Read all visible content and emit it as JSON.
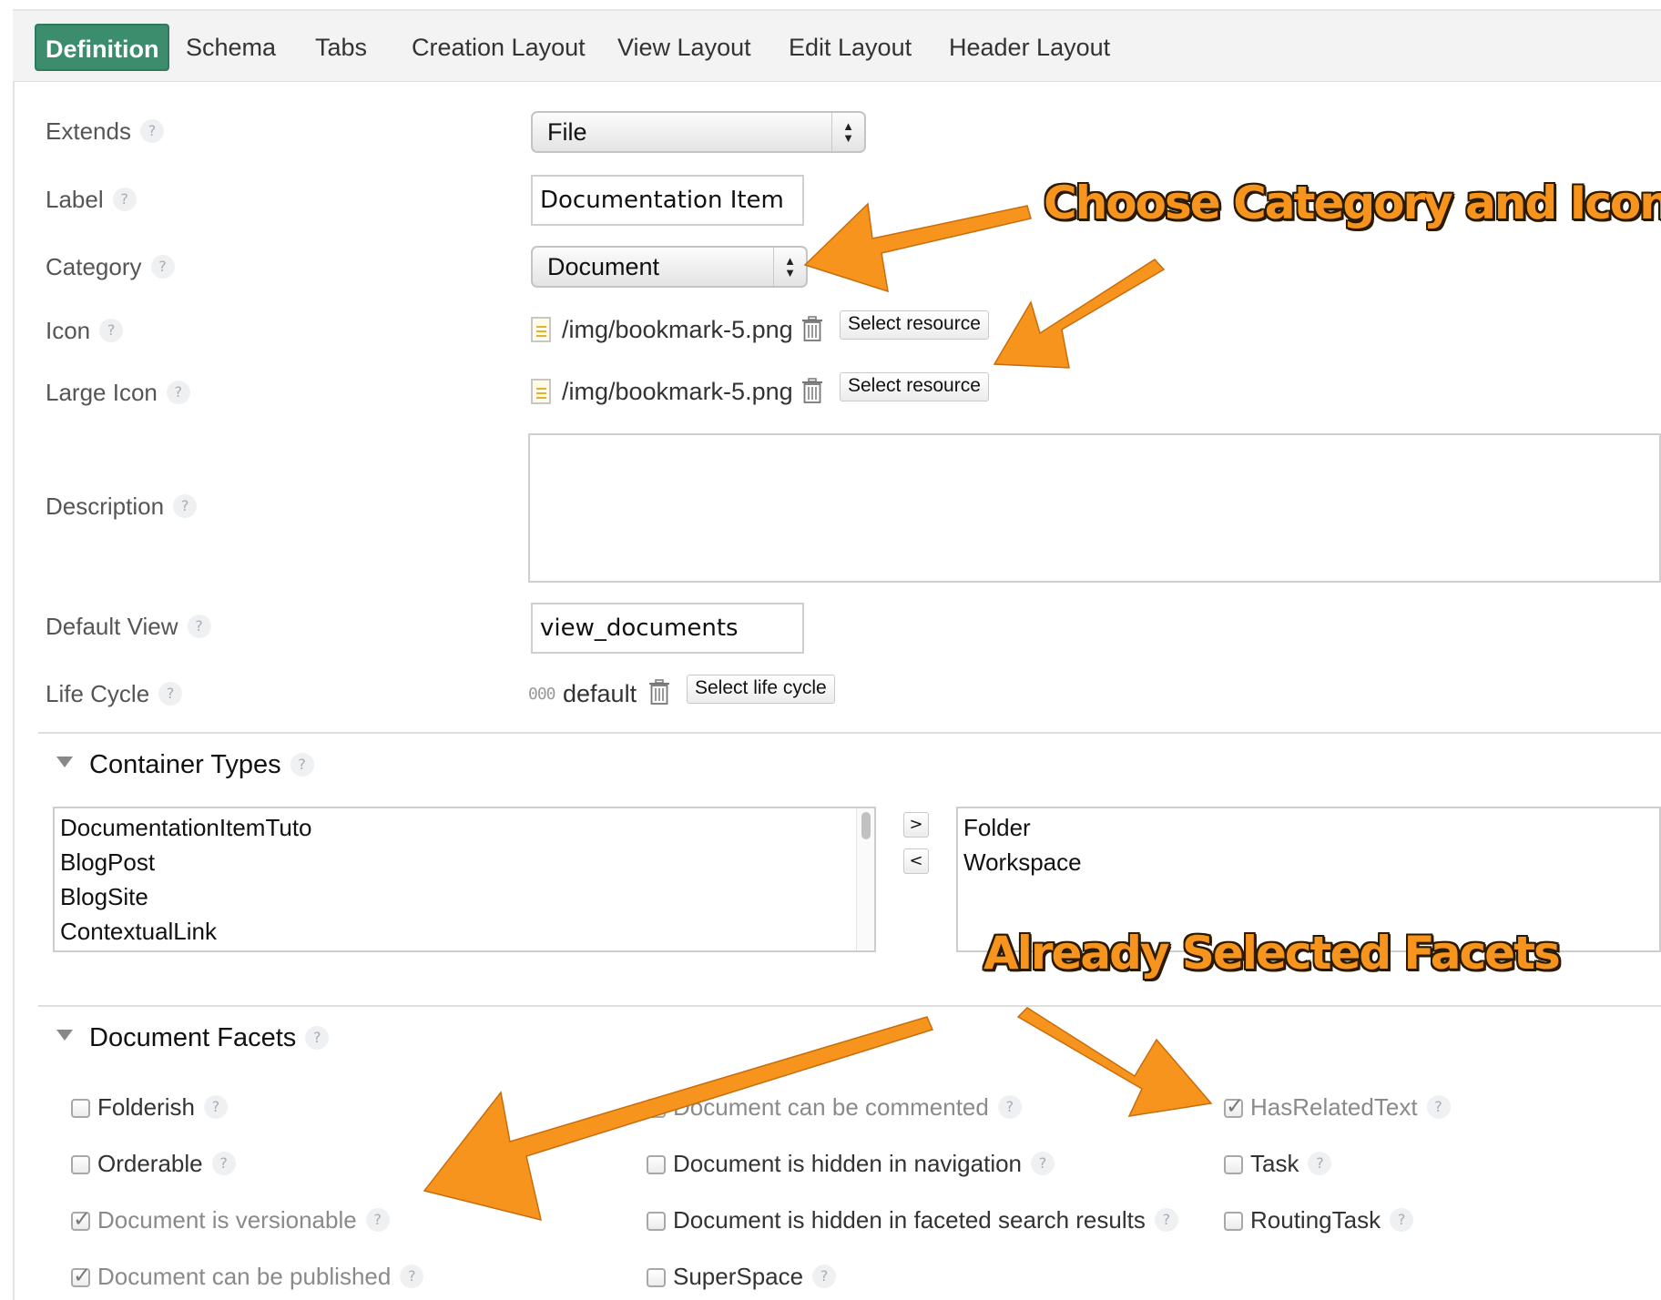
{
  "tabs": [
    {
      "label": "Definition",
      "active": true
    },
    {
      "label": "Schema",
      "active": false
    },
    {
      "label": "Tabs",
      "active": false
    },
    {
      "label": "Creation Layout",
      "active": false
    },
    {
      "label": "View Layout",
      "active": false
    },
    {
      "label": "Edit Layout",
      "active": false
    },
    {
      "label": "Header Layout",
      "active": false
    }
  ],
  "help_glyph": "?",
  "form": {
    "extends": {
      "label": "Extends",
      "value": "File"
    },
    "label": {
      "label": "Label",
      "value": "Documentation Item"
    },
    "category": {
      "label": "Category",
      "value": "Document"
    },
    "icon": {
      "label": "Icon",
      "path": "/img/bookmark-5.png",
      "button": "Select resource"
    },
    "large_icon": {
      "label": "Large Icon",
      "path": "/img/bookmark-5.png",
      "button": "Select resource"
    },
    "description": {
      "label": "Description",
      "value": ""
    },
    "default_view": {
      "label": "Default View",
      "value": "view_documents"
    },
    "life_cycle": {
      "label": "Life Cycle",
      "icon_text": "000",
      "value": "default",
      "button": "Select life cycle"
    }
  },
  "container_types": {
    "title": "Container Types",
    "available": [
      "DocumentationItemTuto",
      "BlogPost",
      "BlogSite",
      "ContextualLink"
    ],
    "selected": [
      "Folder",
      "Workspace"
    ],
    "add_button": ">",
    "remove_button": "<"
  },
  "document_facets": {
    "title": "Document Facets",
    "items": [
      {
        "label": "Folderish",
        "checked": false,
        "disabled": false
      },
      {
        "label": "Orderable",
        "checked": false,
        "disabled": false
      },
      {
        "label": "Document is versionable",
        "checked": true,
        "disabled": true
      },
      {
        "label": "Document can be published",
        "checked": true,
        "disabled": true
      },
      {
        "label": "Document can be commented",
        "checked": true,
        "disabled": true
      },
      {
        "label": "Document is hidden in navigation",
        "checked": false,
        "disabled": false
      },
      {
        "label": "Document is hidden in faceted search results",
        "checked": false,
        "disabled": false
      },
      {
        "label": "SuperSpace",
        "checked": false,
        "disabled": false
      },
      {
        "label": "HasRelatedText",
        "checked": true,
        "disabled": true
      },
      {
        "label": "Task",
        "checked": false,
        "disabled": false
      },
      {
        "label": "RoutingTask",
        "checked": false,
        "disabled": false
      }
    ]
  },
  "annotations": {
    "category_icons": "Choose Category and Icons",
    "selected_facets": "Already Selected Facets",
    "arrow_color": "#f7941d"
  }
}
